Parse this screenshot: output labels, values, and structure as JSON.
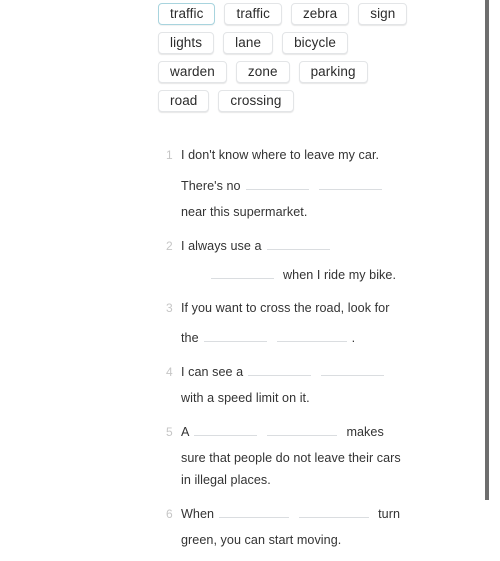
{
  "exercise": {
    "word_bank": {
      "name": "word-bank",
      "rows": [
        [
          {
            "label": "traffic",
            "selected": true
          },
          {
            "label": "traffic",
            "selected": false
          },
          {
            "label": "zebra",
            "selected": false
          },
          {
            "label": "sign",
            "selected": false
          }
        ],
        [
          {
            "label": "lights",
            "selected": false
          },
          {
            "label": "lane",
            "selected": false
          },
          {
            "label": "bicycle",
            "selected": false
          }
        ],
        [
          {
            "label": "warden",
            "selected": false
          },
          {
            "label": "zone",
            "selected": false
          },
          {
            "label": "parking",
            "selected": false
          }
        ],
        [
          {
            "label": "road",
            "selected": false
          },
          {
            "label": "crossing",
            "selected": false
          }
        ]
      ]
    },
    "questions": [
      {
        "number": "1",
        "line1_text": "I don't know where to leave my car.",
        "line2_before": "There's no",
        "blank_count_line2": 2,
        "line3_text": "near this supermarket."
      },
      {
        "number": "2",
        "line1_text": "I always use a",
        "blank_count_line1": 1,
        "line2_blanks": 1,
        "line2_after": "when I ride my bike."
      },
      {
        "number": "3",
        "line1_text": "If you want to cross the road, look for",
        "line2_before": "the",
        "blank_count_line2": 2,
        "line2_after": "."
      },
      {
        "number": "4",
        "line1_text": "I can see a",
        "blank_count_line1": 2,
        "line2_text": "with a speed limit on it."
      },
      {
        "number": "5",
        "line1_before": "A",
        "blank_count_line1": 2,
        "line1_after": "makes",
        "line2_text": "sure that people do not leave their cars",
        "line3_text": "in illegal places."
      },
      {
        "number": "6",
        "line1_before": "When",
        "blank_count_line1": 2,
        "line1_after": "turn",
        "line2_text": "green, you can start moving."
      }
    ]
  },
  "colors": {
    "selected_chip_border": "#a8d4de",
    "chip_border": "#e3e5e7",
    "text": "#333333",
    "number": "#c6c6c6",
    "blank_line": "#dadde0",
    "scrollbar": "#6e6e6e"
  }
}
